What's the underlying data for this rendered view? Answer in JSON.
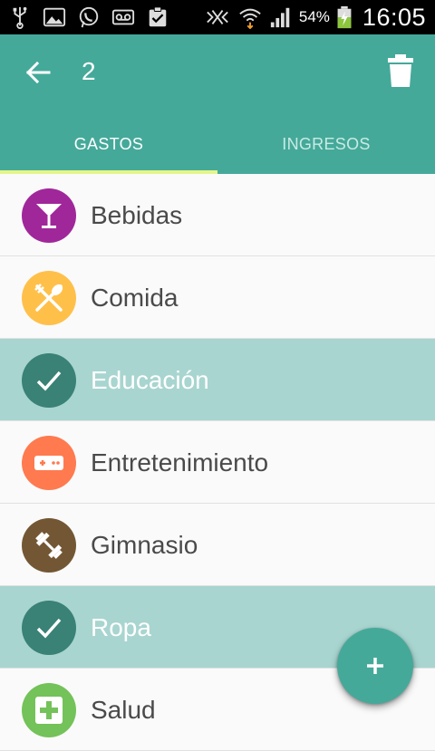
{
  "status_bar": {
    "battery_percent": "54%",
    "time": "16:05",
    "icons_left": [
      "usb-icon",
      "image-icon",
      "whatsapp-icon",
      "voicemail-icon",
      "clipboard-check-icon"
    ],
    "icons_right": [
      "nfc-muted-icon",
      "wifi-icon",
      "signal-icon",
      "battery-charging-icon"
    ]
  },
  "app_bar": {
    "title": "2",
    "back_icon": "arrow-back-icon",
    "delete_icon": "trash-icon",
    "background": "#45a99a"
  },
  "tabs": [
    {
      "label": "GASTOS",
      "active": true
    },
    {
      "label": "INGRESOS",
      "active": false
    }
  ],
  "categories": [
    {
      "label": "Bebidas",
      "icon": "cocktail-icon",
      "color": "#a0279a",
      "selected": false
    },
    {
      "label": "Comida",
      "icon": "fork-spoon-icon",
      "color": "#ffc04a",
      "selected": false
    },
    {
      "label": "Educación",
      "icon": "check-icon",
      "color": "#3a8176",
      "selected": true
    },
    {
      "label": "Entretenimiento",
      "icon": "gamepad-icon",
      "color": "#ff7a4f",
      "selected": false
    },
    {
      "label": "Gimnasio",
      "icon": "dumbbell-icon",
      "color": "#735734",
      "selected": false
    },
    {
      "label": "Ropa",
      "icon": "check-icon",
      "color": "#3a8176",
      "selected": true
    },
    {
      "label": "Salud",
      "icon": "health-cross-icon",
      "color": "#74c25a",
      "selected": false
    }
  ],
  "fab": {
    "icon": "plus-icon",
    "label": "+"
  },
  "colors": {
    "accent": "#45a99a",
    "tab_indicator": "#e4f58c",
    "selected_row": "#a8d5d0"
  }
}
